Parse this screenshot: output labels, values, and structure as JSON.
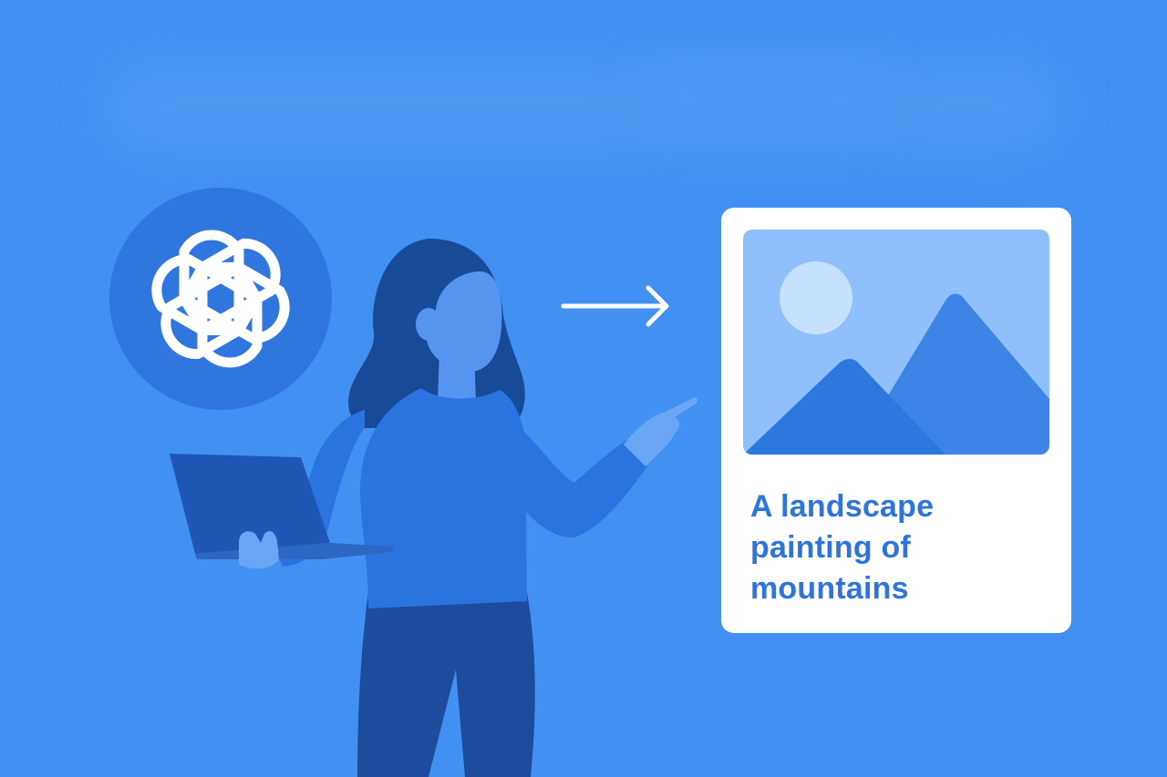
{
  "colors": {
    "background": "#4290f1",
    "haze": "#4b96f1",
    "logo_circle": "#2f76de",
    "logo_stroke": "#ffffff",
    "hair": "#174a97",
    "skin": "#5595f0",
    "skin_light": "#6ba6f5",
    "sweater": "#2b73df",
    "pants": "#1c4c9b",
    "laptop": "#1f58b4",
    "laptop_edge": "#2c67c4",
    "arrow": "#ffffff",
    "card": "#ffffff",
    "image_sky": "#8fc0fb",
    "sun": "#c6e1fe",
    "mountain": "#2e77df",
    "mountain_light": "#3d84e6",
    "caption_text": "#2d74dd"
  },
  "icons": {
    "logo": "openai-logo-icon",
    "arrow": "arrow-right-icon",
    "image": "landscape-image-icon"
  },
  "card": {
    "caption": "A landscape painting of mountains"
  }
}
